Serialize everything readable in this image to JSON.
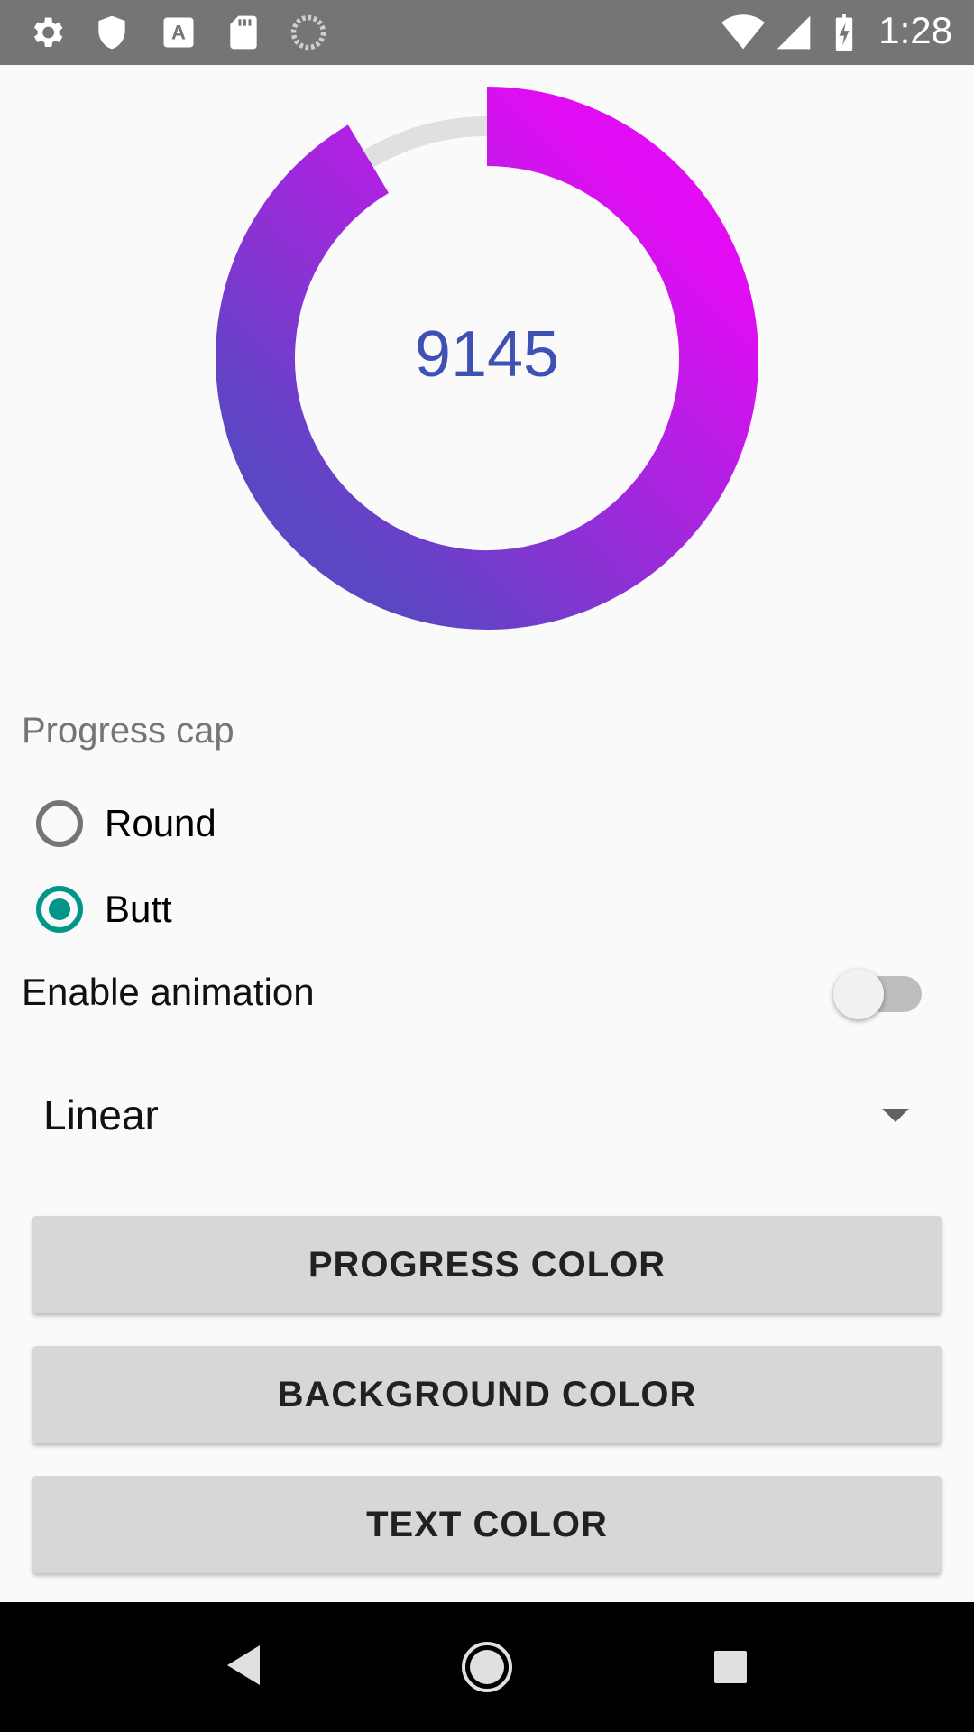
{
  "status_bar": {
    "time": "1:28",
    "icons": [
      "gear-icon",
      "shield-icon",
      "a-font-icon",
      "sd-card-icon",
      "sync-icon",
      "wifi-icon",
      "cell-signal-icon",
      "battery-charging-icon"
    ]
  },
  "progress": {
    "value_text": "9145",
    "fraction": 0.9145,
    "colors": {
      "start": "#5c46c3",
      "end": "#e20cf4",
      "track": "#e0e0e0"
    }
  },
  "progress_cap": {
    "label": "Progress cap",
    "options": [
      {
        "label": "Round",
        "checked": false
      },
      {
        "label": "Butt",
        "checked": true
      }
    ]
  },
  "animation": {
    "label": "Enable animation",
    "enabled": false
  },
  "interpolator": {
    "selected": "Linear"
  },
  "buttons": {
    "progress_color": "PROGRESS COLOR",
    "background_color": "BACKGROUND COLOR",
    "text_color": "TEXT COLOR"
  },
  "nav_bar": {
    "icons": [
      "back-icon",
      "home-icon",
      "recents-icon"
    ]
  },
  "accent_color": "#009688"
}
